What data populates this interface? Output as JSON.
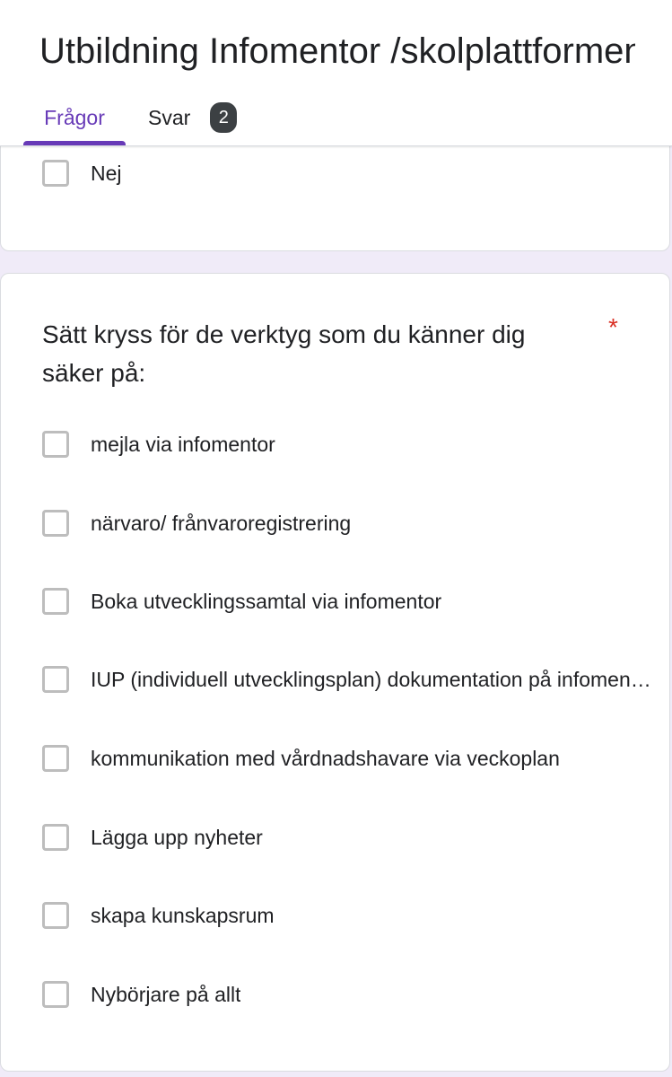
{
  "header": {
    "title": "Utbildning Infomentor /skolplattformen",
    "tabs": [
      {
        "label": "Frågor",
        "active": true
      },
      {
        "label": "Svar",
        "badge": "2",
        "active": false
      }
    ]
  },
  "previous_question": {
    "options": [
      {
        "label": "Nej",
        "checked": false
      }
    ]
  },
  "question": {
    "title": "Sätt kryss för de verktyg som du känner dig säker på:",
    "required_marker": "*",
    "options": [
      {
        "label": "mejla via infomentor",
        "checked": false
      },
      {
        "label": "närvaro/ frånvaroregistrering",
        "checked": false
      },
      {
        "label": "Boka utvecklingssamtal via infomentor",
        "checked": false
      },
      {
        "label": "IUP (individuell utvecklingsplan) dokumentation på infomentor",
        "checked": false
      },
      {
        "label": "kommunikation med vårdnadshavare via veckoplan",
        "checked": false
      },
      {
        "label": "Lägga upp nyheter",
        "checked": false
      },
      {
        "label": "skapa kunskapsrum",
        "checked": false
      },
      {
        "label": "Nybörjare på allt",
        "checked": false
      }
    ]
  },
  "colors": {
    "accent": "#673ab7",
    "background": "#f0ebf8",
    "required": "#d93025",
    "badge": "#3c4043",
    "checkbox_border": "#bdbdbd"
  }
}
